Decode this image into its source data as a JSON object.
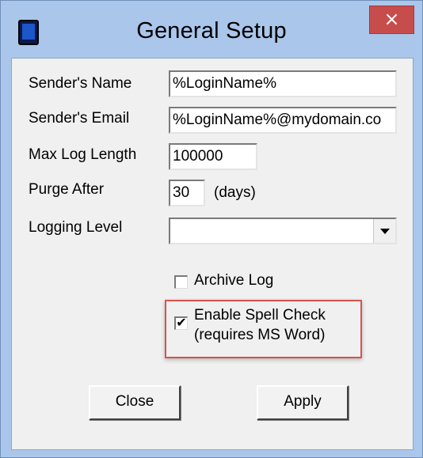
{
  "window": {
    "title": "General Setup",
    "close_glyph": "×"
  },
  "fields": {
    "senders_name": {
      "label": "Sender's Name",
      "value": "%LoginName%"
    },
    "senders_email": {
      "label": "Sender's Email",
      "value": "%LoginName%@mydomain.co"
    },
    "max_log_length": {
      "label": "Max Log Length",
      "value": "100000"
    },
    "purge_after": {
      "label": "Purge After",
      "value": "30",
      "unit": "(days)"
    },
    "logging_level": {
      "label": "Logging Level",
      "value": ""
    }
  },
  "checkboxes": {
    "archive_log": {
      "label": "Archive Log",
      "checked": false,
      "mark": ""
    },
    "enable_spell_check": {
      "label_line1": "Enable Spell Check",
      "label_line2": "(requires MS Word)",
      "checked": true,
      "mark": "✔"
    }
  },
  "buttons": {
    "close": "Close",
    "apply": "Apply"
  },
  "colors": {
    "title_bar": "#aac6ea",
    "close_button": "#c74d4d",
    "highlight": "#d9534f"
  },
  "icons": {
    "app": "device-icon",
    "close": "close-icon",
    "dropdown": "chevron-down-icon",
    "check": "checkmark-icon"
  }
}
